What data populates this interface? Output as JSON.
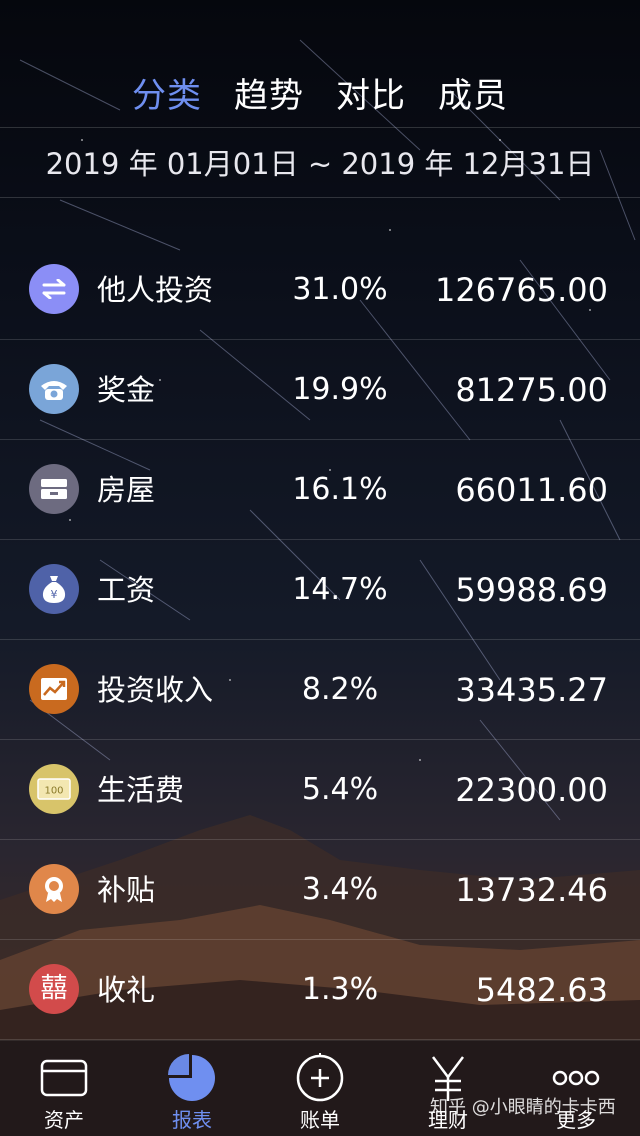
{
  "tabs": [
    {
      "label": "分类",
      "active": true
    },
    {
      "label": "趋势",
      "active": false
    },
    {
      "label": "对比",
      "active": false
    },
    {
      "label": "成员",
      "active": false
    }
  ],
  "date_range": "2019 年 01月01日 ~ 2019 年 12月31日",
  "categories": [
    {
      "name": "他人投资",
      "percent": "31.0%",
      "amount": "126765.00",
      "icon": "transfer-arrows-icon",
      "color": "#8b8ef6"
    },
    {
      "name": "奖金",
      "percent": "19.9%",
      "amount": "81275.00",
      "icon": "telephone-icon",
      "color": "#7aa5d8"
    },
    {
      "name": "房屋",
      "percent": "16.1%",
      "amount": "66011.60",
      "icon": "cabinet-icon",
      "color": "#6d6b80"
    },
    {
      "name": "工资",
      "percent": "14.7%",
      "amount": "59988.69",
      "icon": "money-bag-icon",
      "color": "#4f62a8"
    },
    {
      "name": "投资收入",
      "percent": "8.2%",
      "amount": "33435.27",
      "icon": "trend-chart-icon",
      "color": "#c96a1f"
    },
    {
      "name": "生活费",
      "percent": "5.4%",
      "amount": "22300.00",
      "icon": "banknote-100-icon",
      "color": "#d8c46a",
      "icon_text": "100"
    },
    {
      "name": "补贴",
      "percent": "3.4%",
      "amount": "13732.46",
      "icon": "medal-icon",
      "color": "#e0874a"
    },
    {
      "name": "收礼",
      "percent": "1.3%",
      "amount": "5482.63",
      "icon": "double-happiness-icon",
      "color": "#d24b4b",
      "icon_text": "囍"
    }
  ],
  "tabbar": [
    {
      "label": "资产",
      "icon": "card-icon",
      "active": false
    },
    {
      "label": "报表",
      "icon": "pie-chart-icon",
      "active": true
    },
    {
      "label": "账单",
      "icon": "add-circle-icon",
      "active": false
    },
    {
      "label": "理财",
      "icon": "yen-icon",
      "active": false
    },
    {
      "label": "更多",
      "icon": "more-dots-icon",
      "active": false
    }
  ],
  "watermark": "知乎 @小眼睛的卡卡西",
  "accent_color": "#6f8ff0"
}
